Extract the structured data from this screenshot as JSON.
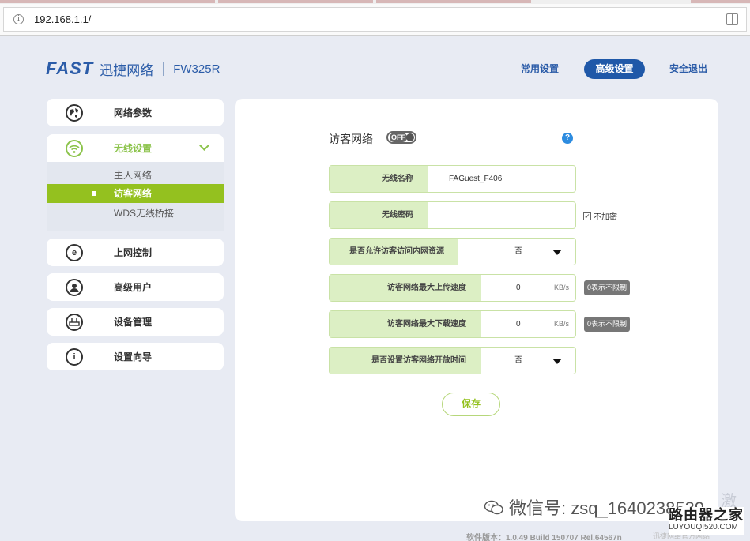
{
  "browser": {
    "url": "192.168.1.1/"
  },
  "header": {
    "logo_brand": "FAST",
    "logo_cn": "迅捷网络",
    "model": "FW325R",
    "nav": {
      "common": "常用设置",
      "advanced": "高级设置",
      "logout": "安全退出"
    }
  },
  "sidebar": {
    "items": [
      {
        "label": "网络参数",
        "icon": "globe-icon"
      },
      {
        "label": "无线设置",
        "icon": "wifi-icon"
      },
      {
        "label": "上网控制",
        "icon": "internet-e-icon"
      },
      {
        "label": "高级用户",
        "icon": "user-icon"
      },
      {
        "label": "设备管理",
        "icon": "router-icon"
      },
      {
        "label": "设置向导",
        "icon": "info-icon"
      }
    ],
    "wireless_sub": [
      "主人网络",
      "访客网络",
      "WDS无线桥接"
    ]
  },
  "main": {
    "title": "访客网络",
    "toggle": "OFF",
    "help": "?",
    "fields": {
      "ssid_label": "无线名称",
      "ssid_value": "FAGuest_F406",
      "password_label": "无线密码",
      "password_value": "",
      "no_encrypt": "不加密",
      "allow_internal_label": "是否允许访客访问内网资源",
      "allow_internal_value": "否",
      "upload_label": "访客网络最大上传速度",
      "upload_value": "0",
      "upload_unit": "KB/s",
      "upload_hint": "0表示不限制",
      "download_label": "访客网络最大下载速度",
      "download_value": "0",
      "download_unit": "KB/s",
      "download_hint": "0表示不限制",
      "schedule_label": "是否设置访客网络开放时间",
      "schedule_value": "否"
    },
    "save": "保存"
  },
  "footer": {
    "version": "软件版本：1.0.49 Build 150707 Rel.64567n",
    "brand": "迅捷网络官方网站"
  },
  "overlay": {
    "wechat": "微信号: zsq_1640238539",
    "activate": "激活",
    "site_cn": "路由器之家",
    "site_url": "LUYOUQI520.COM"
  },
  "colors": {
    "brand_blue": "#2b5ca8",
    "accent_green": "#94c11f",
    "field_label_bg": "#dcefc4"
  }
}
